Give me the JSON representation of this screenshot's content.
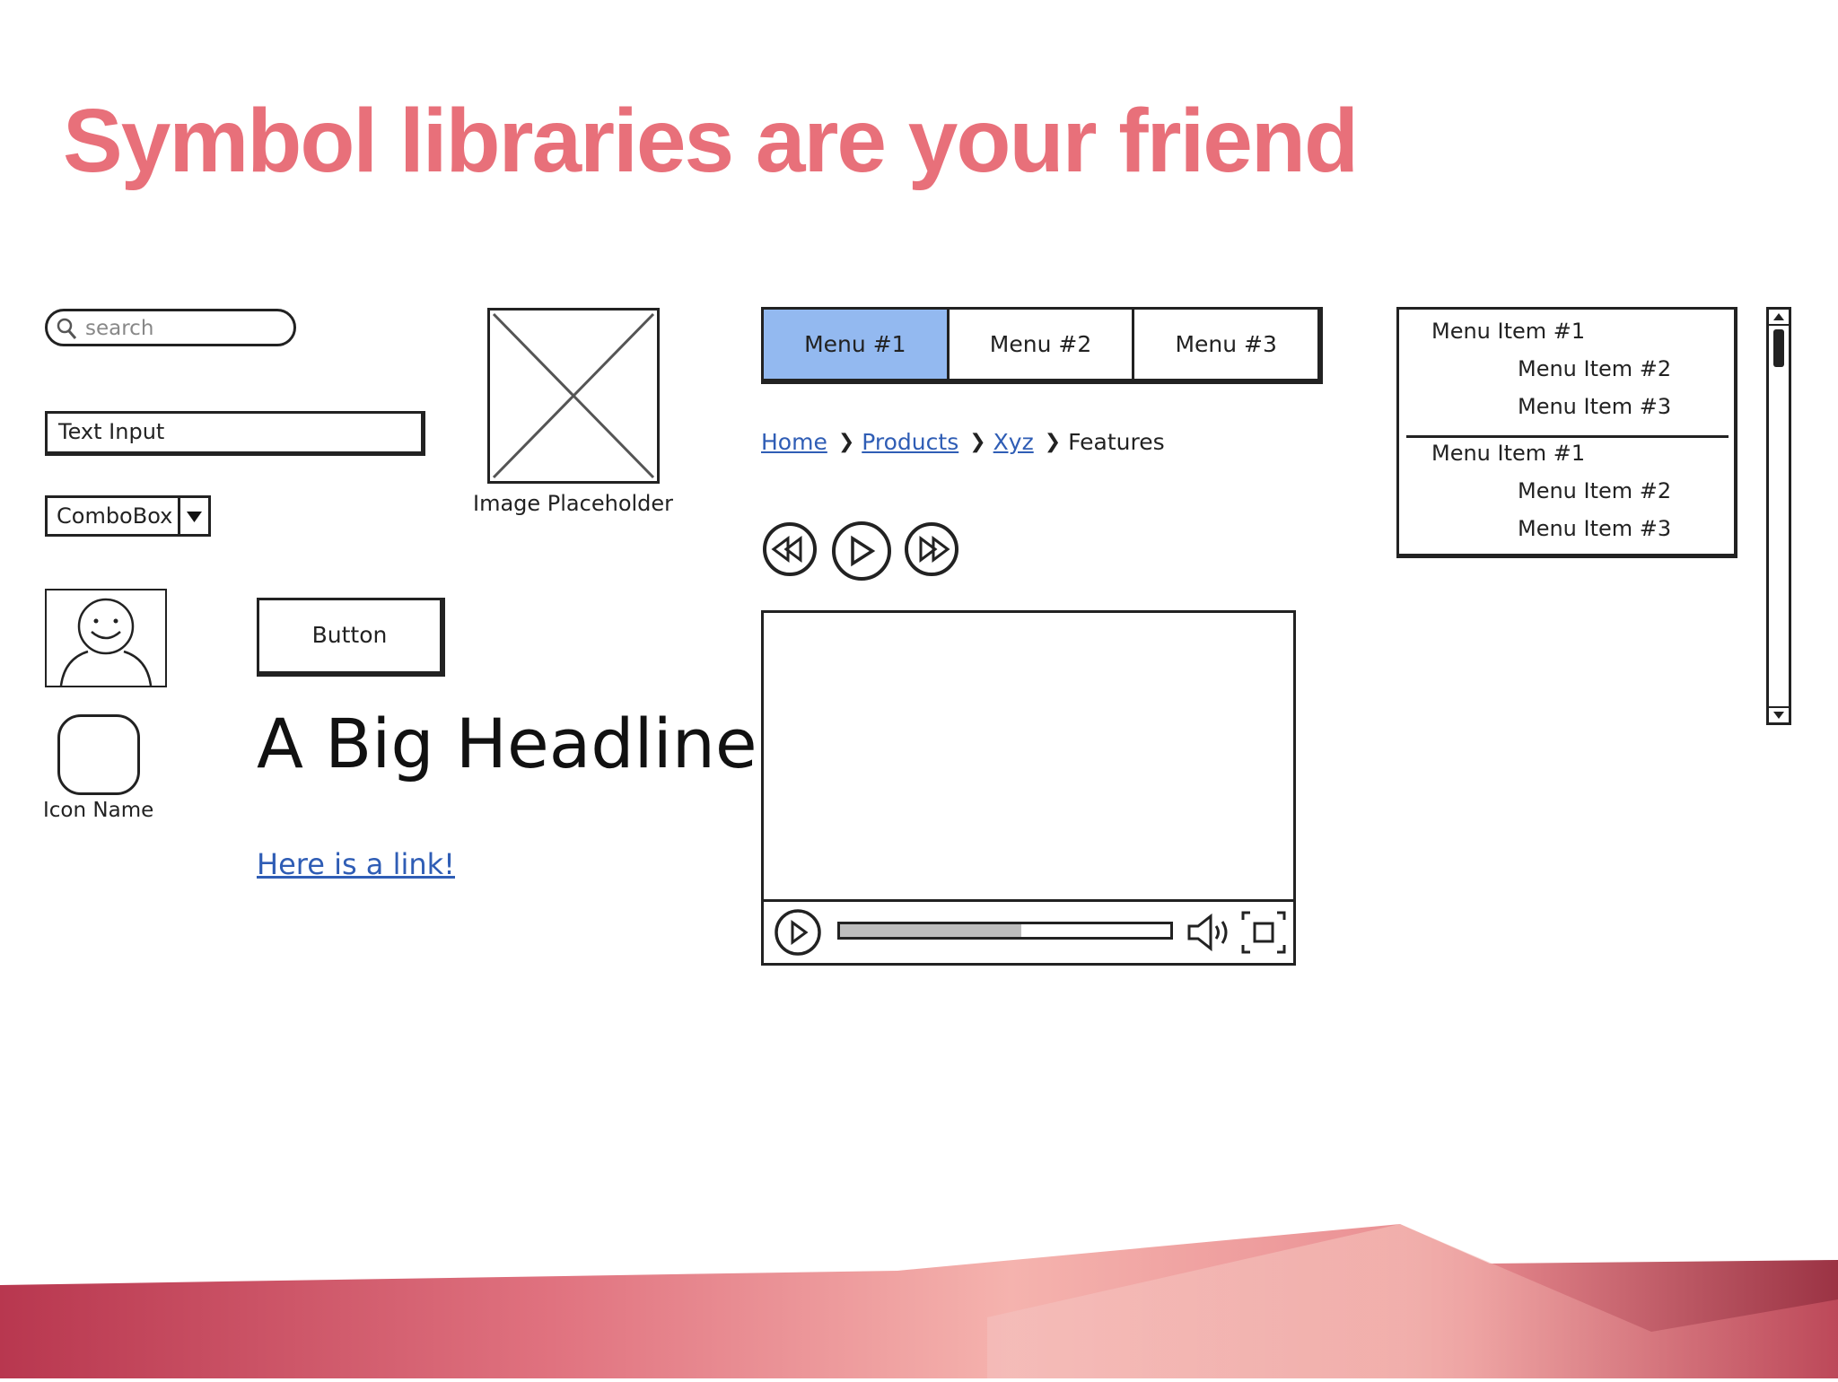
{
  "slide": {
    "title": "Symbol libraries are your friend"
  },
  "widgets": {
    "search": {
      "placeholder": "search",
      "icon": "search-icon"
    },
    "text_input": {
      "value": "Text Input"
    },
    "combobox": {
      "value": "ComboBox",
      "icon": "dropdown-arrow-icon"
    },
    "avatar": {
      "icon": "user-avatar-icon"
    },
    "icon": {
      "name": "Icon Name",
      "icon": "blank-icon"
    },
    "image_placeholder": {
      "label": "Image Placeholder",
      "icon": "image-placeholder-icon"
    },
    "button": {
      "label": "Button"
    },
    "headline": {
      "text": "A Big Headline"
    },
    "link": {
      "text": "Here is a link!"
    },
    "menubar": {
      "items": [
        {
          "label": "Menu #1",
          "active": true
        },
        {
          "label": "Menu #2",
          "active": false
        },
        {
          "label": "Menu #3",
          "active": false
        }
      ],
      "active_color": "#93b9f0"
    },
    "breadcrumbs": {
      "items": [
        "Home",
        "Products",
        "Xyz",
        "Features"
      ]
    },
    "media_controls": {
      "icons": [
        "rewind-icon",
        "play-icon",
        "fast-forward-icon"
      ]
    },
    "video_player": {
      "progress": 0.55,
      "icons": [
        "play-icon",
        "volume-icon",
        "fullscreen-icon"
      ]
    },
    "menu_list": {
      "groups": [
        [
          "Menu Item #1",
          "Menu Item #2",
          "Menu Item #3"
        ],
        [
          "Menu Item #1",
          "Menu Item #2",
          "Menu Item #3"
        ]
      ]
    },
    "scrollbar": {
      "icons": [
        "scroll-up-icon",
        "scroll-down-icon"
      ]
    }
  },
  "colors": {
    "title": "#e8707a",
    "link": "#2f5db5"
  }
}
